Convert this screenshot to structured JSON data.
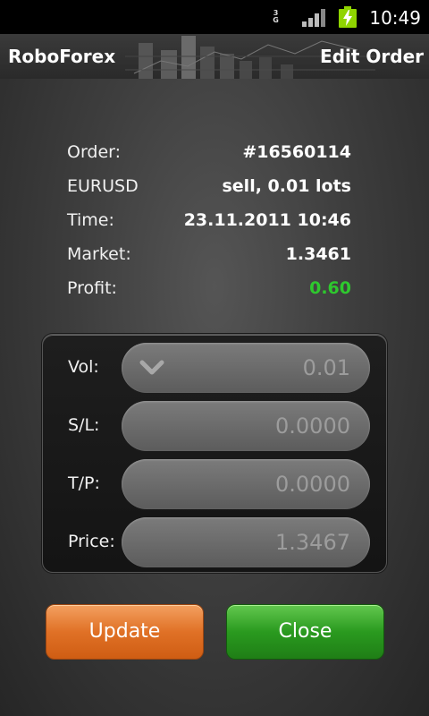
{
  "status_bar": {
    "network": "3G",
    "time": "10:49",
    "icons": [
      "signal-icon",
      "battery-charging-icon"
    ]
  },
  "header": {
    "app_title": "RoboForex",
    "screen_title": "Edit Order"
  },
  "order_info": [
    {
      "label": "Order:",
      "value": "#16560114"
    },
    {
      "label": "EURUSD",
      "value": "sell, 0.01 lots"
    },
    {
      "label": "Time:",
      "value": "23.11.2011 10:46"
    },
    {
      "label": "Market:",
      "value": "1.3461"
    },
    {
      "label": "Profit:",
      "value": "0.60"
    }
  ],
  "edit_form": {
    "vol": {
      "label": "Vol:",
      "value": "0.01"
    },
    "sl": {
      "label": "S/L:",
      "value": "0.0000"
    },
    "tp": {
      "label": "T/P:",
      "value": "0.0000"
    },
    "price": {
      "label": "Price:",
      "value": "1.3467"
    }
  },
  "buttons": {
    "update": "Update",
    "close": "Close"
  },
  "colors": {
    "profit": "#2ec82e",
    "update_button": "#e07126",
    "close_button": "#2a9a1f",
    "battery": "#8fd400"
  }
}
